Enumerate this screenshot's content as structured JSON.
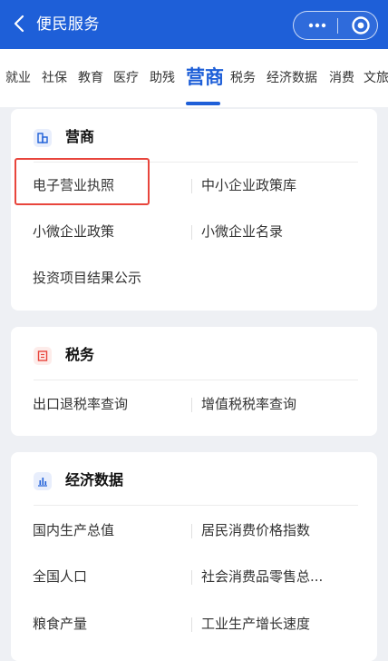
{
  "header": {
    "title": "便民服务"
  },
  "tabs": [
    "就业",
    "社保",
    "教育",
    "医疗",
    "助残",
    "营商",
    "税务",
    "经济数据",
    "消费",
    "文旅"
  ],
  "active_tab": "营商",
  "sections": [
    {
      "title": "营商",
      "icon": "building-icon",
      "items": [
        "电子营业执照",
        "中小企业政策库",
        "小微企业政策",
        "小微企业名录",
        "投资项目结果公示"
      ]
    },
    {
      "title": "税务",
      "icon": "tax-icon",
      "items": [
        "出口退税率查询",
        "增值税税率查询"
      ]
    },
    {
      "title": "经济数据",
      "icon": "bar-chart-icon",
      "items": [
        "国内生产总值",
        "居民消费价格指数",
        "全国人口",
        "社会消费品零售总...",
        "粮食产量",
        "工业生产增长速度"
      ]
    }
  ],
  "colors": {
    "primary": "#1e5fd8",
    "highlight": "#e8453c",
    "tax_icon": "#e8453c"
  }
}
